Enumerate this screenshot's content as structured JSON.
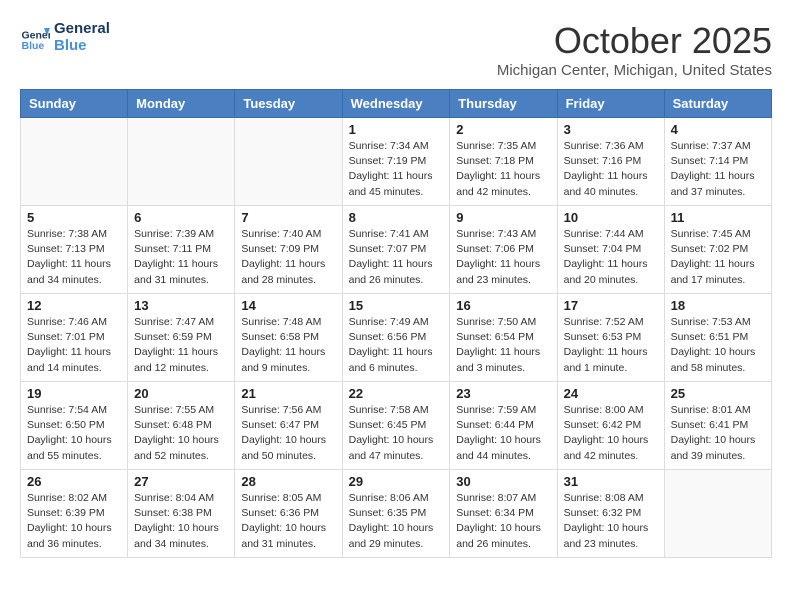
{
  "header": {
    "logo_line1": "General",
    "logo_line2": "Blue",
    "month": "October 2025",
    "location": "Michigan Center, Michigan, United States"
  },
  "weekdays": [
    "Sunday",
    "Monday",
    "Tuesday",
    "Wednesday",
    "Thursday",
    "Friday",
    "Saturday"
  ],
  "weeks": [
    [
      {
        "day": "",
        "detail": ""
      },
      {
        "day": "",
        "detail": ""
      },
      {
        "day": "",
        "detail": ""
      },
      {
        "day": "1",
        "detail": "Sunrise: 7:34 AM\nSunset: 7:19 PM\nDaylight: 11 hours and 45 minutes."
      },
      {
        "day": "2",
        "detail": "Sunrise: 7:35 AM\nSunset: 7:18 PM\nDaylight: 11 hours and 42 minutes."
      },
      {
        "day": "3",
        "detail": "Sunrise: 7:36 AM\nSunset: 7:16 PM\nDaylight: 11 hours and 40 minutes."
      },
      {
        "day": "4",
        "detail": "Sunrise: 7:37 AM\nSunset: 7:14 PM\nDaylight: 11 hours and 37 minutes."
      }
    ],
    [
      {
        "day": "5",
        "detail": "Sunrise: 7:38 AM\nSunset: 7:13 PM\nDaylight: 11 hours and 34 minutes."
      },
      {
        "day": "6",
        "detail": "Sunrise: 7:39 AM\nSunset: 7:11 PM\nDaylight: 11 hours and 31 minutes."
      },
      {
        "day": "7",
        "detail": "Sunrise: 7:40 AM\nSunset: 7:09 PM\nDaylight: 11 hours and 28 minutes."
      },
      {
        "day": "8",
        "detail": "Sunrise: 7:41 AM\nSunset: 7:07 PM\nDaylight: 11 hours and 26 minutes."
      },
      {
        "day": "9",
        "detail": "Sunrise: 7:43 AM\nSunset: 7:06 PM\nDaylight: 11 hours and 23 minutes."
      },
      {
        "day": "10",
        "detail": "Sunrise: 7:44 AM\nSunset: 7:04 PM\nDaylight: 11 hours and 20 minutes."
      },
      {
        "day": "11",
        "detail": "Sunrise: 7:45 AM\nSunset: 7:02 PM\nDaylight: 11 hours and 17 minutes."
      }
    ],
    [
      {
        "day": "12",
        "detail": "Sunrise: 7:46 AM\nSunset: 7:01 PM\nDaylight: 11 hours and 14 minutes."
      },
      {
        "day": "13",
        "detail": "Sunrise: 7:47 AM\nSunset: 6:59 PM\nDaylight: 11 hours and 12 minutes."
      },
      {
        "day": "14",
        "detail": "Sunrise: 7:48 AM\nSunset: 6:58 PM\nDaylight: 11 hours and 9 minutes."
      },
      {
        "day": "15",
        "detail": "Sunrise: 7:49 AM\nSunset: 6:56 PM\nDaylight: 11 hours and 6 minutes."
      },
      {
        "day": "16",
        "detail": "Sunrise: 7:50 AM\nSunset: 6:54 PM\nDaylight: 11 hours and 3 minutes."
      },
      {
        "day": "17",
        "detail": "Sunrise: 7:52 AM\nSunset: 6:53 PM\nDaylight: 11 hours and 1 minute."
      },
      {
        "day": "18",
        "detail": "Sunrise: 7:53 AM\nSunset: 6:51 PM\nDaylight: 10 hours and 58 minutes."
      }
    ],
    [
      {
        "day": "19",
        "detail": "Sunrise: 7:54 AM\nSunset: 6:50 PM\nDaylight: 10 hours and 55 minutes."
      },
      {
        "day": "20",
        "detail": "Sunrise: 7:55 AM\nSunset: 6:48 PM\nDaylight: 10 hours and 52 minutes."
      },
      {
        "day": "21",
        "detail": "Sunrise: 7:56 AM\nSunset: 6:47 PM\nDaylight: 10 hours and 50 minutes."
      },
      {
        "day": "22",
        "detail": "Sunrise: 7:58 AM\nSunset: 6:45 PM\nDaylight: 10 hours and 47 minutes."
      },
      {
        "day": "23",
        "detail": "Sunrise: 7:59 AM\nSunset: 6:44 PM\nDaylight: 10 hours and 44 minutes."
      },
      {
        "day": "24",
        "detail": "Sunrise: 8:00 AM\nSunset: 6:42 PM\nDaylight: 10 hours and 42 minutes."
      },
      {
        "day": "25",
        "detail": "Sunrise: 8:01 AM\nSunset: 6:41 PM\nDaylight: 10 hours and 39 minutes."
      }
    ],
    [
      {
        "day": "26",
        "detail": "Sunrise: 8:02 AM\nSunset: 6:39 PM\nDaylight: 10 hours and 36 minutes."
      },
      {
        "day": "27",
        "detail": "Sunrise: 8:04 AM\nSunset: 6:38 PM\nDaylight: 10 hours and 34 minutes."
      },
      {
        "day": "28",
        "detail": "Sunrise: 8:05 AM\nSunset: 6:36 PM\nDaylight: 10 hours and 31 minutes."
      },
      {
        "day": "29",
        "detail": "Sunrise: 8:06 AM\nSunset: 6:35 PM\nDaylight: 10 hours and 29 minutes."
      },
      {
        "day": "30",
        "detail": "Sunrise: 8:07 AM\nSunset: 6:34 PM\nDaylight: 10 hours and 26 minutes."
      },
      {
        "day": "31",
        "detail": "Sunrise: 8:08 AM\nSunset: 6:32 PM\nDaylight: 10 hours and 23 minutes."
      },
      {
        "day": "",
        "detail": ""
      }
    ]
  ]
}
